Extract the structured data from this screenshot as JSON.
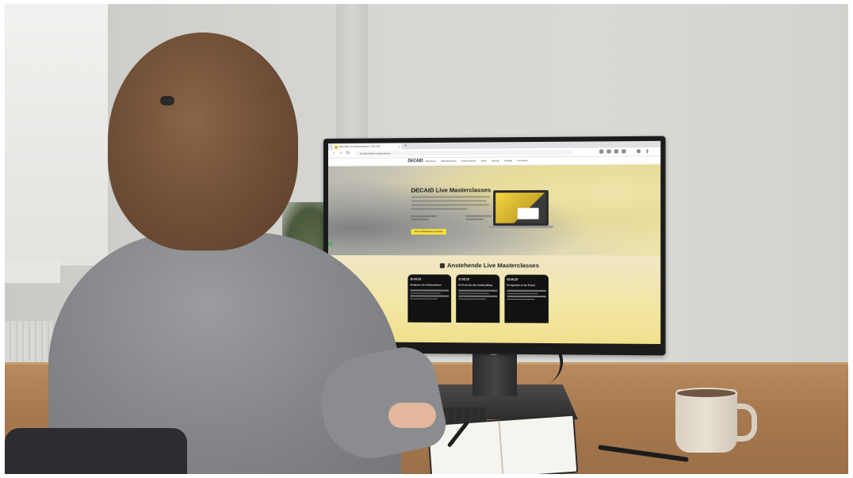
{
  "browser": {
    "tab_title": "DECAID Live Masterclasses | DECAID",
    "tab_close": "×",
    "new_tab": "+",
    "url": "decaid.de/live-masterclasses",
    "nav": {
      "back": "‹",
      "forward": "›",
      "reload": "↻"
    }
  },
  "site": {
    "logo": "DECAID",
    "nav_links": [
      "Akademie",
      "Masterclasses",
      "Unternehmen",
      "Team",
      "Events",
      "Kontakt",
      "Anmelden"
    ]
  },
  "hero": {
    "title": "DECAID Live Masterclasses",
    "cta_label": "Jetzt für Masterclass anmelden"
  },
  "upcoming": {
    "title": "Anstehende Live Masterclasses",
    "cards": [
      {
        "date": "20.05.25",
        "title": "KI-Basics für Unternehmen"
      },
      {
        "date": "27.05.25",
        "title": "KI-Tools für den Arbeitsalltag"
      },
      {
        "date": "03.06.25",
        "title": "KI-Agenten in der Praxis"
      }
    ]
  },
  "colors": {
    "accent_yellow": "#f5e03a",
    "card_dark": "#121212",
    "hero_gradient_end": "#ede3a9"
  }
}
